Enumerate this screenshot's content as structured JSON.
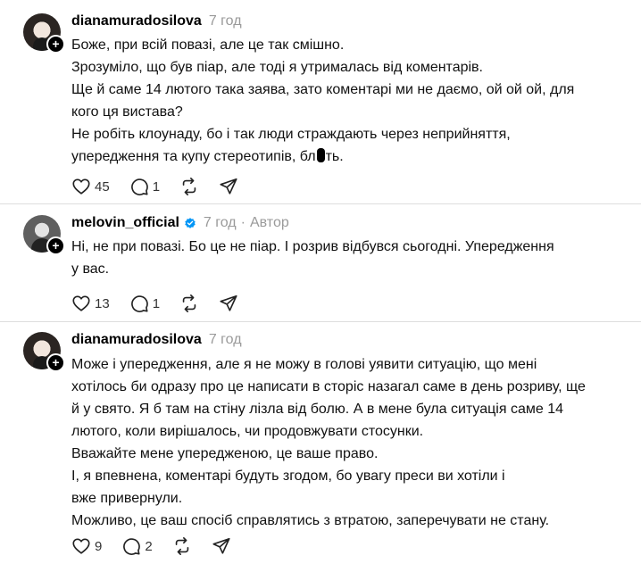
{
  "posts": [
    {
      "username": "dianamuradosilova",
      "time": "7 год",
      "role": "",
      "lines": [
        "Боже, при всій повазі, але це так смішно.",
        "Зрозуміло, що був піар, але тоді я утрималась від коментарів.",
        "Ще й саме 14 лютого така заява, зато коментарі ми не даємо, ой ой ой, для",
        "кого ця вистава?",
        "Не робіть клоунаду, бо і так люди страждають через неприйняття,",
        "упередження та купу стереотипів, бл",
        "ть."
      ],
      "likes": "45",
      "replies": "1"
    },
    {
      "username": "melovin_official",
      "time": "7 год",
      "role": "Автор",
      "lines": [
        "Ні, не при повазі. Бо це не піар. І розрив відбувся сьогодні. Упередження",
        "у вас."
      ],
      "likes": "13",
      "replies": "1"
    },
    {
      "username": "dianamuradosilova",
      "time": "7 год",
      "role": "",
      "lines": [
        "Може і упередження, але я не можу в голові уявити ситуацію, що мені",
        "хотілось би одразу про це написати в сторіс назагал саме в день розриву, ще",
        "й у свято. Я б там на стіну лізла від болю. А в мене була ситуація саме 14",
        "лютого, коли вирішалось, чи продовжувати стосунки.",
        "Вважайте мене упередженою, це ваше право.",
        "І, я впевнена, коментарі будуть згодом, бо увагу преси ви хотіли і",
        "вже привернули.",
        "Можливо, це ваш спосіб справлятись з втратою, заперечувати не стану."
      ],
      "likes": "9",
      "replies": "2"
    }
  ],
  "colors": {
    "verified": "#0095f6",
    "meta": "#9a9a9a",
    "divider": "#dedede"
  },
  "icons": {
    "like": "heart-icon",
    "reply": "comment-icon",
    "repost": "repost-icon",
    "share": "share-icon",
    "follow": "plus-icon",
    "verified": "verified-badge-icon"
  }
}
